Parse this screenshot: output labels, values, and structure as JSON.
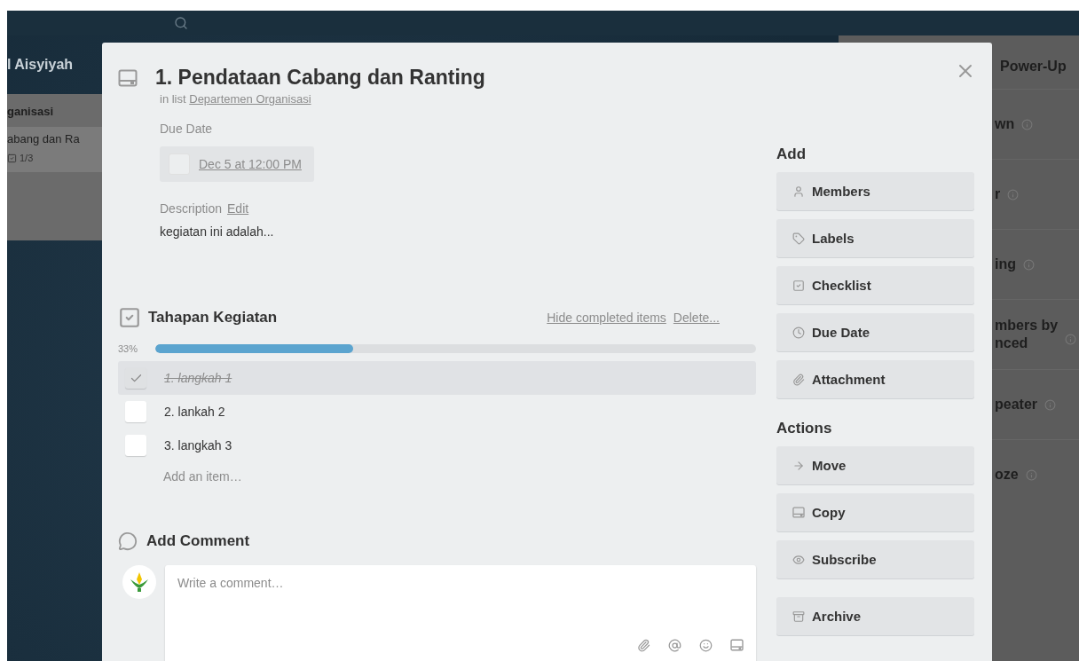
{
  "board": {
    "title": "l Aisyiyah",
    "list": {
      "title": "ganisasi",
      "card": {
        "title": "abang dan Ra",
        "checklist_badge": "1/3"
      }
    }
  },
  "powerups": {
    "title": "Power-Up",
    "items": [
      {
        "lines": [
          "wn"
        ]
      },
      {
        "lines": [
          "r"
        ]
      },
      {
        "lines": [
          "ing"
        ]
      },
      {
        "lines": [
          "mbers by",
          "nced"
        ]
      },
      {
        "lines": [
          "peater"
        ]
      },
      {
        "lines": [
          "oze"
        ]
      }
    ]
  },
  "card": {
    "title": "1. Pendataan Cabang dan Ranting",
    "list_prefix": "in list",
    "list_name": "Departemen Organisasi",
    "due_label": "Due Date",
    "due_date": "Dec 5 at 12:00 PM",
    "due_checked": false,
    "description_label": "Description",
    "description_edit": "Edit",
    "description": "kegiatan ini adalah...",
    "checklist": {
      "title": "Tahapan Kegiatan",
      "hide_link": "Hide completed items",
      "delete_link": "Delete...",
      "percent": "33%",
      "level": 0.33,
      "items": [
        {
          "text": "1. langkah 1",
          "checked": true
        },
        {
          "text": "2. lankah 2",
          "checked": false
        },
        {
          "text": "3. langkah 3",
          "checked": false
        }
      ],
      "add_item": "Add an item…"
    },
    "comment": {
      "title": "Add Comment",
      "placeholder": "Write a comment…"
    }
  },
  "sidebar": {
    "add_title": "Add",
    "add_buttons": [
      "Members",
      "Labels",
      "Checklist",
      "Due Date",
      "Attachment"
    ],
    "actions_title": "Actions",
    "action_buttons": [
      "Move",
      "Copy",
      "Subscribe",
      "Archive"
    ]
  }
}
